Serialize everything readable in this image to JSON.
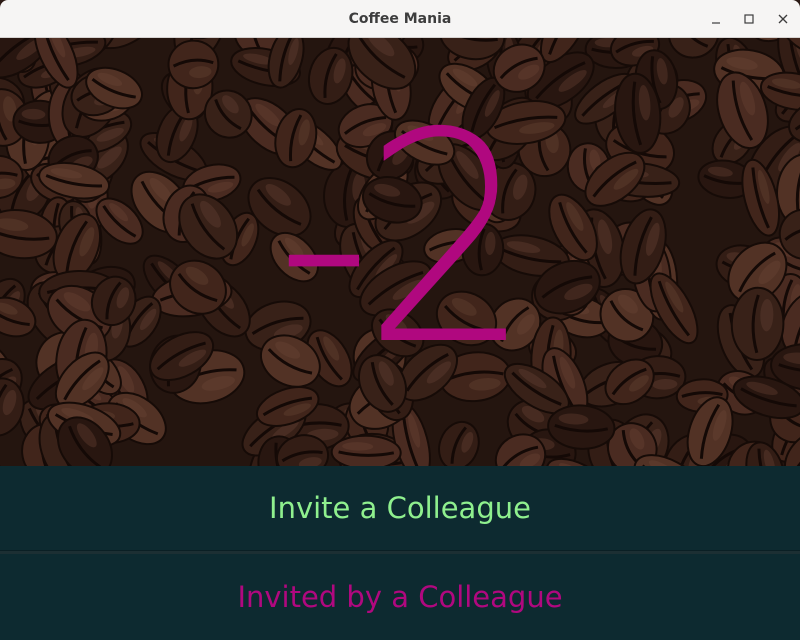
{
  "window": {
    "title": "Coffee Mania",
    "controls": {
      "minimize_icon": "minimize-icon",
      "maximize_icon": "maximize-icon",
      "close_icon": "close-icon"
    }
  },
  "hero": {
    "background": "coffee-beans-image",
    "counter": "-2",
    "counter_color": "#b0087f"
  },
  "actions": {
    "invite_label": "Invite a Colleague",
    "invite_color": "#8ff08e",
    "invited_label": "Invited by a Colleague",
    "invited_color": "#b0087f",
    "panel_color": "#0d2a30"
  }
}
